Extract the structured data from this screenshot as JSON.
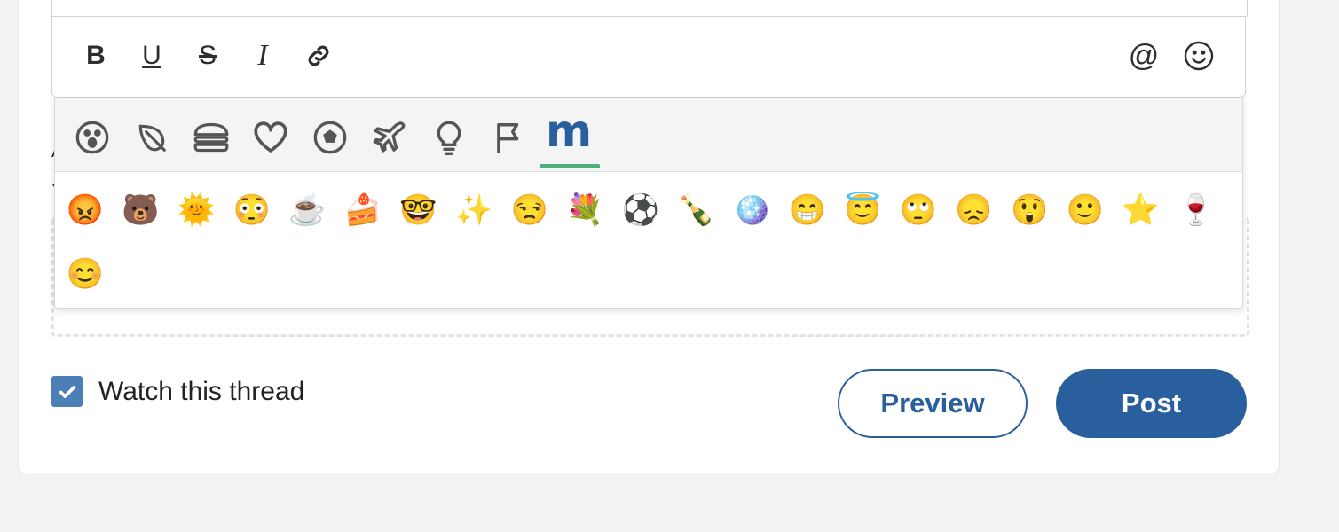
{
  "toolbar": {
    "buttons": [
      {
        "name": "bold-button",
        "glyph": "B"
      },
      {
        "name": "underline-button",
        "glyph": "U"
      },
      {
        "name": "strikethrough-button",
        "glyph": "S"
      },
      {
        "name": "italic-button",
        "glyph": "I"
      },
      {
        "name": "link-button",
        "glyph": "link-icon"
      },
      {
        "name": "mention-button",
        "glyph": "@"
      },
      {
        "name": "emoji-button",
        "glyph": "smiley-icon"
      }
    ]
  },
  "picker": {
    "tabs": [
      {
        "name": "tab-smileys",
        "icon": "surprised-face-icon"
      },
      {
        "name": "tab-nature",
        "icon": "leaf-icon"
      },
      {
        "name": "tab-food",
        "icon": "burger-icon"
      },
      {
        "name": "tab-symbols-heart",
        "icon": "heart-icon"
      },
      {
        "name": "tab-activity",
        "icon": "soccer-ball-icon"
      },
      {
        "name": "tab-travel",
        "icon": "airplane-icon"
      },
      {
        "name": "tab-objects",
        "icon": "lightbulb-icon"
      },
      {
        "name": "tab-flags",
        "icon": "flag-icon"
      },
      {
        "name": "tab-custom",
        "icon": "m-logo",
        "label": "m"
      }
    ],
    "emojis": [
      "😡",
      "🐻",
      "🌞",
      "😳",
      "☕",
      "🍰",
      "🤓",
      "✨",
      "😒",
      "💐",
      "⚽",
      "🍾",
      "🪩",
      "😁",
      "😇",
      "🙄",
      "😞",
      "😲",
      "🙂",
      "⭐",
      "🍷",
      "😊"
    ]
  },
  "behind": {
    "letter1": "A",
    "letter2": "Y"
  },
  "footer": {
    "watch_checked": true,
    "watch_label": "Watch this thread",
    "preview_label": "Preview",
    "post_label": "Post"
  },
  "colors": {
    "brand": "#2a5f9e",
    "accent_underline": "#4caf7a",
    "checkbox": "#4b7fb5"
  }
}
